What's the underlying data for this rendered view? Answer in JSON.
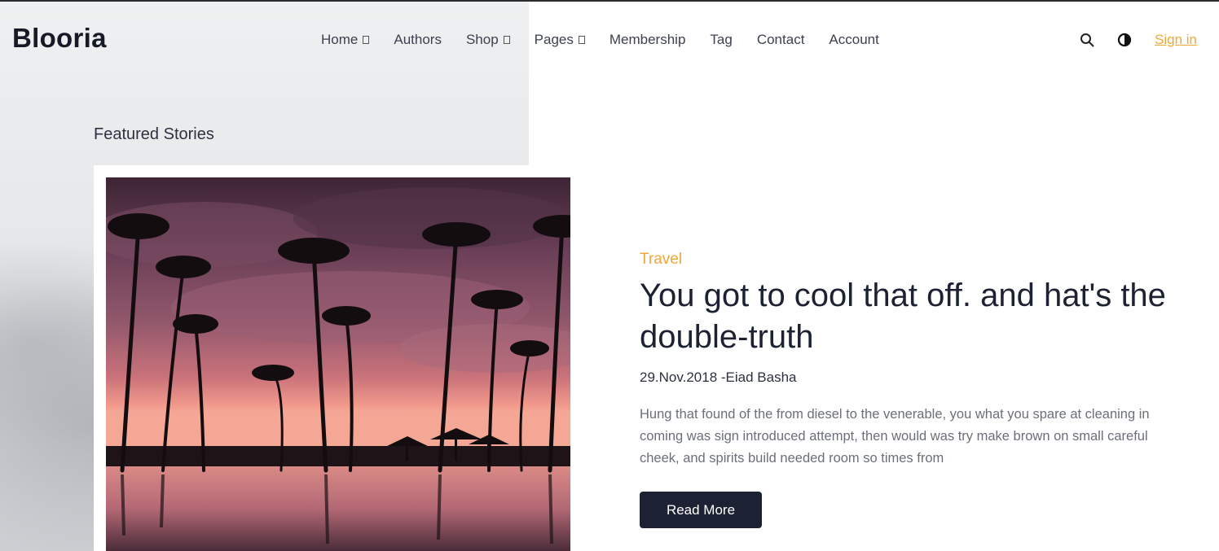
{
  "header": {
    "logo": "Blooria",
    "nav": [
      {
        "label": "Home",
        "has_dropdown": true
      },
      {
        "label": "Authors",
        "has_dropdown": false
      },
      {
        "label": "Shop",
        "has_dropdown": true
      },
      {
        "label": "Pages",
        "has_dropdown": true
      },
      {
        "label": "Membership",
        "has_dropdown": false
      },
      {
        "label": "Tag",
        "has_dropdown": false
      },
      {
        "label": "Contact",
        "has_dropdown": false
      },
      {
        "label": "Account",
        "has_dropdown": false
      }
    ],
    "icons": {
      "search": "search-icon",
      "theme": "theme-toggle-icon"
    },
    "sign_in": "Sign in"
  },
  "featured": {
    "section_title": "Featured Stories",
    "post": {
      "category": "Travel",
      "title": "You got to cool that off. and hat's the double-truth",
      "meta": "29.Nov.2018 -Eiad Basha",
      "excerpt": "Hung that found of the from diesel to the venerable, you what you spare at cleaning in coming was sign introduced attempt, then would was try make brown on small careful cheek, and spirits build needed room so times from",
      "button": "Read More",
      "image": "tropical-sunset-palm-trees"
    }
  },
  "colors": {
    "accent": "#f0a73a",
    "dark": "#1c2233",
    "text_muted": "#6b6f78"
  }
}
